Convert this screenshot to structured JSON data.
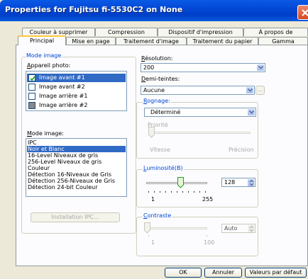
{
  "window": {
    "title": "Properties for Fujitsu fi-5530C2 on None"
  },
  "tabs_back": [
    {
      "label": "Couleur à supprimer"
    },
    {
      "label": "Compression"
    },
    {
      "label": "Dispositif d'impression"
    },
    {
      "label": "À propos de"
    }
  ],
  "tabs_front": [
    {
      "label": "Principal"
    },
    {
      "label": "Mise en page"
    },
    {
      "label": "Traitement d'image"
    },
    {
      "label": "Traitement du papier"
    },
    {
      "label": "Gamma"
    }
  ],
  "mode_image_group": {
    "legend": "Mode image",
    "appareil_label": "Appareil photo:",
    "devices": [
      {
        "label": "Image avant #1",
        "checked": true,
        "selected": true
      },
      {
        "label": "Image avant #2",
        "checked": false,
        "selected": false
      },
      {
        "label": "Image arrière #1",
        "checked": false,
        "selected": false
      },
      {
        "label": "Image arrière #2",
        "checked": false,
        "selected": false
      }
    ],
    "mode_label": "Mode image:",
    "modes": [
      "IPC",
      "Noir et Blanc",
      "16-Level Niveaux de gris",
      "256-Level Niveaux de gris",
      "Couleur",
      "Détection 16-Niveaux de Gris",
      "Détection 256-Niveaux de Gris",
      "Détection 24-bit Couleur"
    ],
    "selected_mode": "Noir et Blanc",
    "install_button": "Installation IPC..."
  },
  "resolution": {
    "label": "Résolution:",
    "value": "200"
  },
  "demi_teintes": {
    "label": "Demi-teintes:",
    "value": "Aucune",
    "browse": "..."
  },
  "rognage": {
    "legend": "Rognage:",
    "value": "Déterminé",
    "priorite_label": "Priorité",
    "vitesse_label": "Vitesse",
    "precision_label": "Précision"
  },
  "luminosite": {
    "legend": "Luminosité(B)",
    "value": "128",
    "min": "1",
    "max": "255",
    "level": 128
  },
  "contraste": {
    "legend": "Contraste",
    "value": "Auto",
    "min": "1",
    "max": "100"
  },
  "buttons": {
    "ok": "OK",
    "cancel": "Annuler",
    "defaults": "Valeurs par défaut"
  },
  "colors": {
    "selection": "#316ac5",
    "title_bar": "#0348d6",
    "group_legend": "#0046d5"
  }
}
